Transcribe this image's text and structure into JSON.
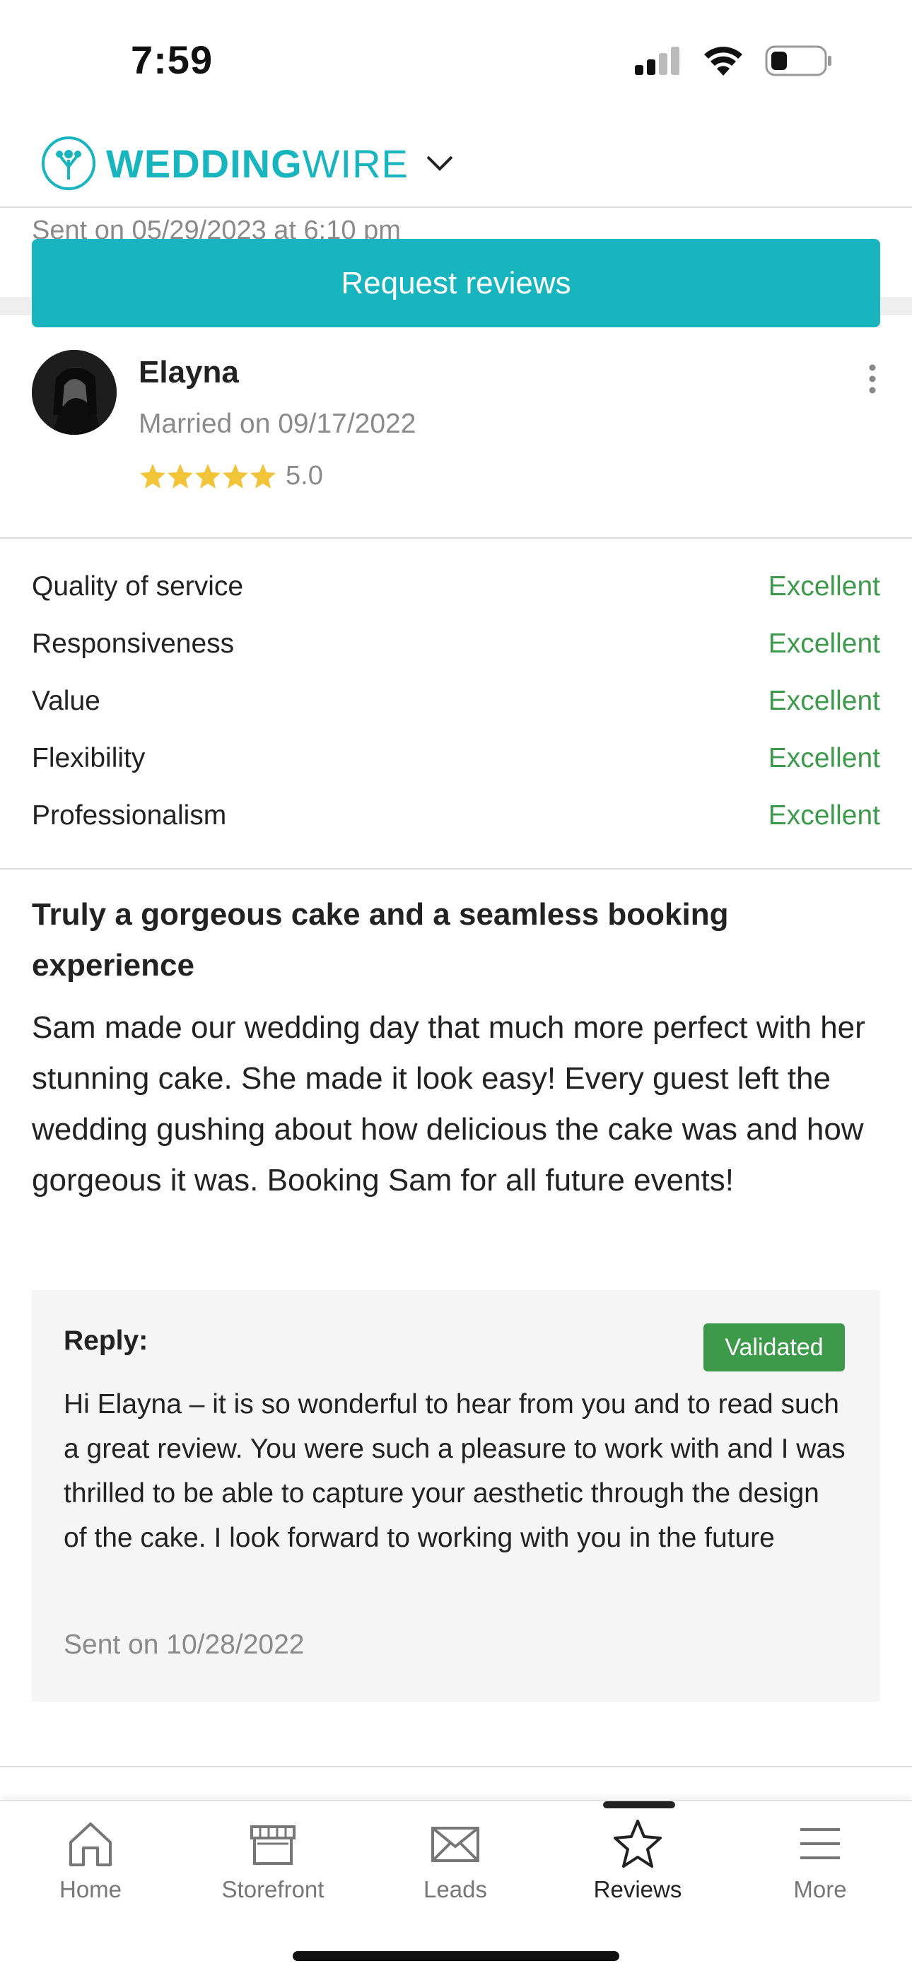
{
  "status_bar": {
    "time": "7:59"
  },
  "header": {
    "brand_bold": "WEDDING",
    "brand_rest": "WIRE"
  },
  "peek_text": "Sent on 05/29/2023 at 6:10 pm",
  "request_button_label": "Request reviews",
  "review": {
    "name": "Elayna",
    "married": "Married on 09/17/2022",
    "rating": "5.0",
    "stars": 5,
    "criteria": [
      {
        "label": "Quality of service",
        "value": "Excellent"
      },
      {
        "label": "Responsiveness",
        "value": "Excellent"
      },
      {
        "label": "Value",
        "value": "Excellent"
      },
      {
        "label": "Flexibility",
        "value": "Excellent"
      },
      {
        "label": "Professionalism",
        "value": "Excellent"
      }
    ],
    "title": "Truly a gorgeous cake and a seamless booking experience",
    "body": "Sam made our wedding day that much more perfect with her stunning cake. She made it look easy! Every guest left the wedding gushing about how delicious the cake was and how gorgeous it was. Booking Sam for all future events!",
    "reply": {
      "label": "Reply:",
      "badge": "Validated",
      "text": "Hi Elayna – it is so wonderful to hear from you and to read such a great review. You were such a pleasure to work with and I was thrilled to be able to capture your aesthetic through the design of the cake. I look forward to working with you in the future",
      "sent": "Sent on 10/28/2022"
    }
  },
  "nav": [
    {
      "label": "Home",
      "icon": "home-icon"
    },
    {
      "label": "Storefront",
      "icon": "storefront-icon"
    },
    {
      "label": "Leads",
      "icon": "envelope-icon"
    },
    {
      "label": "Reviews",
      "icon": "star-icon",
      "active": true
    },
    {
      "label": "More",
      "icon": "menu-icon"
    }
  ],
  "colors": {
    "brand": "#19b5bf",
    "excellent": "#3d9a4d",
    "validated": "#3c9a4a",
    "star": "#f2c43a"
  }
}
